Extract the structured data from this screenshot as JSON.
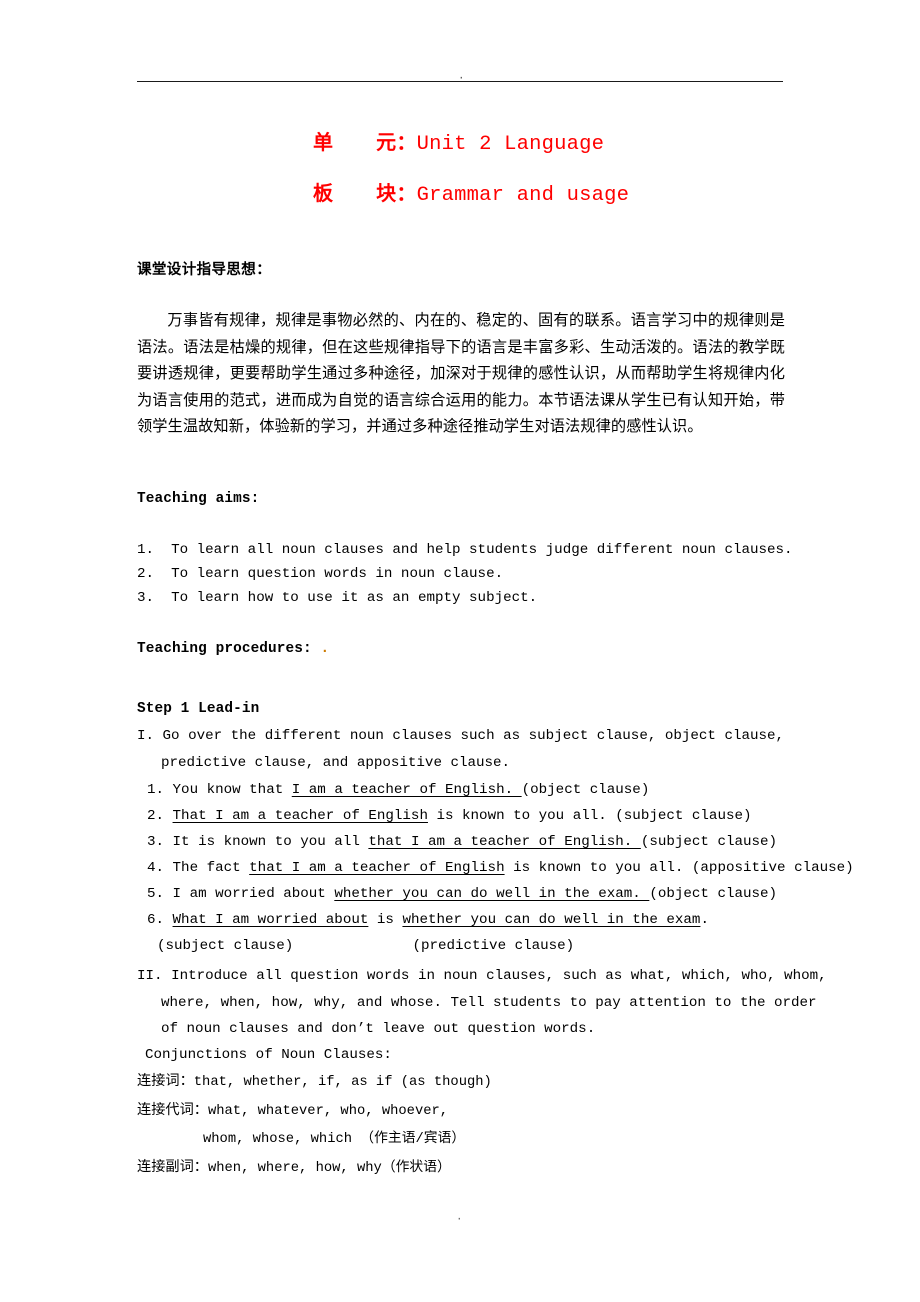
{
  "page": {
    "header_marker": "·",
    "footer_marker": "·",
    "accent_red": "#ff0000",
    "text_color": "#000000"
  },
  "title": {
    "line1_cn": "单      元",
    "line1_sep": "：",
    "line1_en": "Unit 2 Language",
    "line2_cn": "板      块",
    "line2_sep": "：",
    "line2_en": "Grammar and usage"
  },
  "design_idea": {
    "heading": "课堂设计指导思想：",
    "paragraph": "万事皆有规律，规律是事物必然的、内在的、稳定的、固有的联系。语言学习中的规律则是语法。语法是枯燥的规律，但在这些规律指导下的语言是丰富多彩、生动活泼的。语法的教学既要讲透规律，更要帮助学生通过多种途径，加深对于规律的感性认识，从而帮助学生将规律内化为语言使用的范式，进而成为自觉的语言综合运用的能力。本节语法课从学生已有认知开始，带领学生温故知新，体验新的学习，并通过多种途径推动学生对语法规律的感性认识。"
  },
  "teaching_aims": {
    "heading": "Teaching aims:",
    "items": [
      {
        "num": "1.",
        "text": "To learn all noun clauses and help students judge different noun clauses."
      },
      {
        "num": "2.",
        "text": "To learn question words in noun clause."
      },
      {
        "num": "3.",
        "text": "To learn how to use it as an empty subject."
      }
    ]
  },
  "teaching_procedures": {
    "heading": "Teaching procedures:",
    "heading_trailing_mark": "."
  },
  "step1": {
    "heading": "Step 1  Lead-in",
    "roman_i": {
      "marker": "I.",
      "line1": "Go over the different noun clauses such as subject clause, object clause,",
      "line2": "predictive clause, and appositive clause."
    },
    "examples": [
      {
        "num": "1.",
        "parts": [
          {
            "text": "You know that ",
            "underline": false
          },
          {
            "text": "I am a teacher of English. ",
            "underline": true
          },
          {
            "text": "(object clause)",
            "underline": false
          }
        ]
      },
      {
        "num": "2.",
        "parts": [
          {
            "text": "That I am a teacher of English",
            "underline": true
          },
          {
            "text": " is known to you all. (subject clause)",
            "underline": false
          }
        ]
      },
      {
        "num": "3.",
        "parts": [
          {
            "text": "It is known to you all ",
            "underline": false
          },
          {
            "text": "that I am a teacher of English. ",
            "underline": true
          },
          {
            "text": "(subject clause)",
            "underline": false
          }
        ]
      },
      {
        "num": "4.",
        "parts": [
          {
            "text": "The fact ",
            "underline": false
          },
          {
            "text": "that I am a teacher of English",
            "underline": true
          },
          {
            "text": " is known to you all. (appositive clause)",
            "underline": false
          }
        ]
      },
      {
        "num": "5.",
        "parts": [
          {
            "text": "I am worried about ",
            "underline": false
          },
          {
            "text": "whether you can do well in the exam. ",
            "underline": true
          },
          {
            "text": "(object clause)",
            "underline": false
          }
        ]
      },
      {
        "num": "6.",
        "parts": [
          {
            "text": "What I am worried about",
            "underline": true
          },
          {
            "text": " is ",
            "underline": false
          },
          {
            "text": "whether you can do well in the exam",
            "underline": true
          },
          {
            "text": ".",
            "underline": false
          }
        ]
      }
    ],
    "example6_labels": {
      "left": "(subject clause)",
      "right": "(predictive clause)"
    },
    "roman_ii": {
      "marker": "II.",
      "line1": "Introduce all question words in noun clauses, such as what, which, who, whom,",
      "line2": "where, when, how, why, and whose. Tell students to pay attention to the order",
      "line3": "of noun clauses and don’t leave out question words."
    },
    "conjunctions_heading": "Conjunctions of Noun Clauses:",
    "conjunctions": [
      {
        "label": "连接词：",
        "value": "that, whether, if, as if (as though)",
        "indent": false
      },
      {
        "label": "连接代词：",
        "value": "what, whatever, who, whoever,",
        "indent": false
      },
      {
        "label": "",
        "value": "whom, whose, which （作主语/宾语）",
        "indent": true
      },
      {
        "label": "连接副词：",
        "value": "when, where, how, why（作状语）",
        "indent": false
      }
    ]
  }
}
